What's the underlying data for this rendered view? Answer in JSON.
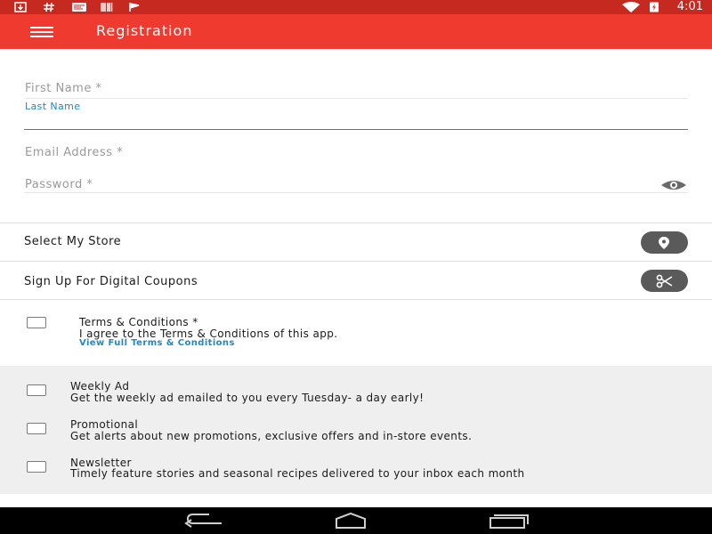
{
  "status_bar": {
    "time": "4:01",
    "icons": [
      "download-icon",
      "hashtag-icon",
      "news-icon",
      "barcode-icon",
      "flag-icon",
      "wifi-icon",
      "battery-charging-icon"
    ]
  },
  "app_bar": {
    "title": "Registration",
    "menu_icon": "hamburger-menu-icon"
  },
  "form": {
    "first_name_placeholder": "First Name *",
    "last_name_label": "Last Name",
    "email_placeholder": "Email Address *",
    "password_placeholder": "Password *",
    "password_toggle_icon": "eye-icon"
  },
  "rows": {
    "select_store": "Select My Store",
    "select_store_icon": "location-pin-icon",
    "digital_coupons": "Sign Up For Digital Coupons",
    "digital_coupons_icon": "scissors-icon"
  },
  "terms": {
    "title": "Terms & Conditions *",
    "text": "I agree to the Terms & Conditions of this app.",
    "link": "View Full Terms & Conditions"
  },
  "subscriptions": [
    {
      "title": "Weekly Ad",
      "description": "Get the weekly ad emailed to you every Tuesday- a day early!"
    },
    {
      "title": "Promotional",
      "description": "Get alerts about new promotions, exclusive offers and in-store events."
    },
    {
      "title": "Newsletter",
      "description": "Timely feature stories and seasonal recipes delivered to your inbox each month"
    }
  ],
  "nav_bar": {
    "icons": [
      "back-icon",
      "home-icon",
      "recents-icon"
    ]
  },
  "colors": {
    "app_bar": "#ef3a2f",
    "status_bar": "#c62920",
    "accent": "#1e88c7",
    "pill": "#5a5a5a"
  }
}
